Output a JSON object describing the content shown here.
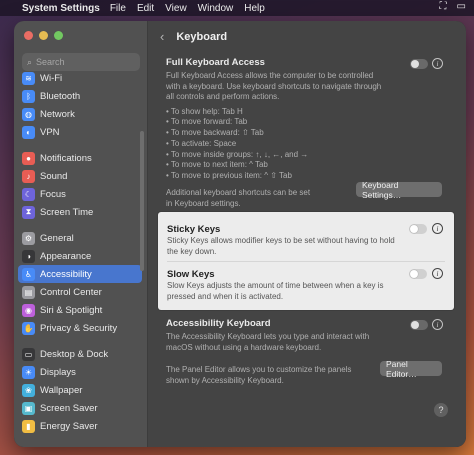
{
  "menubar": {
    "app_name": "System Settings",
    "items": [
      "File",
      "Edit",
      "View",
      "Window",
      "Help"
    ]
  },
  "sidebar": {
    "search_placeholder": "Search",
    "items": [
      {
        "label": "Wi-Fi",
        "icon": "wifi-icon",
        "color": "#2f7cf6",
        "glyph": "≋"
      },
      {
        "label": "Bluetooth",
        "icon": "bluetooth-icon",
        "color": "#2f7cf6",
        "glyph": "ᛒ"
      },
      {
        "label": "Network",
        "icon": "globe-icon",
        "color": "#2f7cf6",
        "glyph": "◍"
      },
      {
        "label": "VPN",
        "icon": "vpn-icon",
        "color": "#2f7cf6",
        "glyph": "◐"
      },
      {
        "label": "Notifications",
        "icon": "bell-icon",
        "color": "#e5473d",
        "glyph": "●"
      },
      {
        "label": "Sound",
        "icon": "speaker-icon",
        "color": "#e5473d",
        "glyph": "♪"
      },
      {
        "label": "Focus",
        "icon": "moon-icon",
        "color": "#5b4fd6",
        "glyph": "☾"
      },
      {
        "label": "Screen Time",
        "icon": "hourglass-icon",
        "color": "#5b4fd6",
        "glyph": "⧗"
      },
      {
        "label": "General",
        "icon": "gear-icon",
        "color": "#8e8e93",
        "glyph": "⚙"
      },
      {
        "label": "Appearance",
        "icon": "appearance-icon",
        "color": "#1c1c1e",
        "glyph": "◑"
      },
      {
        "label": "Accessibility",
        "icon": "accessibility-icon",
        "color": "#2f7cf6",
        "glyph": "♿"
      },
      {
        "label": "Control Center",
        "icon": "control-center-icon",
        "color": "#8e8e93",
        "glyph": "▤"
      },
      {
        "label": "Siri & Spotlight",
        "icon": "siri-icon",
        "color": "#b44ad6",
        "glyph": "◉"
      },
      {
        "label": "Privacy & Security",
        "icon": "hand-icon",
        "color": "#2f7cf6",
        "glyph": "✋"
      },
      {
        "label": "Desktop & Dock",
        "icon": "dock-icon",
        "color": "#1c1c1e",
        "glyph": "▭"
      },
      {
        "label": "Displays",
        "icon": "display-icon",
        "color": "#2f7cf6",
        "glyph": "☀"
      },
      {
        "label": "Wallpaper",
        "icon": "wallpaper-icon",
        "color": "#2aa6d8",
        "glyph": "❀"
      },
      {
        "label": "Screen Saver",
        "icon": "screensaver-icon",
        "color": "#3fb0c6",
        "glyph": "▣"
      },
      {
        "label": "Energy Saver",
        "icon": "battery-icon",
        "color": "#f0b429",
        "glyph": "▮"
      }
    ],
    "active_index": 10
  },
  "main": {
    "title": "Keyboard",
    "full_keyboard_access": {
      "title": "Full Keyboard Access",
      "description": "Full Keyboard Access allows the computer to be controlled with a keyboard. Use keyboard shortcuts to navigate through all controls and perform actions.",
      "shortcuts": [
        "• To show help: Tab H",
        "• To move forward: Tab",
        "• To move backward: ⇧ Tab",
        "• To activate: Space",
        "• To move inside groups: ↑, ↓, ←, and →",
        "• To move to next item: ^ Tab",
        "• To move to previous item: ^ ⇧ Tab"
      ],
      "additional_text": "Additional keyboard shortcuts can be set in Keyboard settings.",
      "button_label": "Keyboard Settings…"
    },
    "sticky_keys": {
      "title": "Sticky Keys",
      "description": "Sticky Keys allows modifier keys to be set without having to hold the key down."
    },
    "slow_keys": {
      "title": "Slow Keys",
      "description": "Slow Keys adjusts the amount of time between when a key is pressed and when it is activated."
    },
    "accessibility_keyboard": {
      "title": "Accessibility Keyboard",
      "description": "The Accessibility Keyboard lets you type and interact with macOS without using a hardware keyboard.",
      "panel_text": "The Panel Editor allows you to customize the panels shown by Accessibility Keyboard.",
      "button_label": "Panel Editor…"
    },
    "help_label": "?",
    "info_glyph": "i"
  }
}
